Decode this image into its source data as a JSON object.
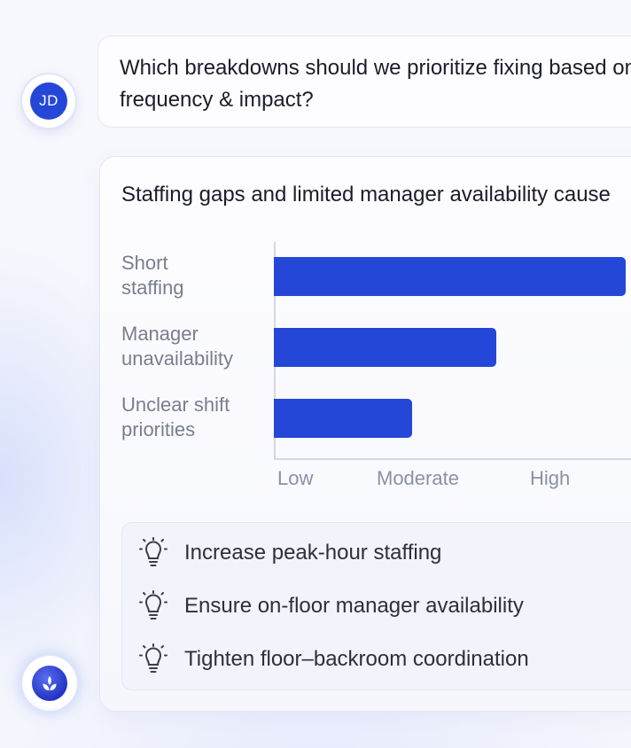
{
  "user": {
    "initials": "JD"
  },
  "question": {
    "line1": "Which breakdowns should we prioritize fixing based on",
    "line2": "frequency & impact?"
  },
  "answer": {
    "intro": "Staffing gaps and limited manager availability cause"
  },
  "chart_data": {
    "type": "bar",
    "orientation": "horizontal",
    "categories": [
      [
        "Short",
        "staffing"
      ],
      [
        "Manager",
        "unavailability"
      ],
      [
        "Unclear shift",
        "priorities"
      ]
    ],
    "values": [
      0.92,
      0.58,
      0.36
    ],
    "x_ticks": [
      "Low",
      "Moderate",
      "High"
    ],
    "color": "#2447d8",
    "grid": false
  },
  "recommendations": [
    {
      "icon": "lightbulb-icon",
      "text": "Increase peak-hour staffing"
    },
    {
      "icon": "lightbulb-icon",
      "text": "Ensure on-floor manager availability"
    },
    {
      "icon": "lightbulb-icon",
      "text": "Tighten floor–backroom coordination"
    }
  ],
  "assistant": {
    "icon": "leaf-icon"
  },
  "colors": {
    "accent": "#2447d8",
    "background": "#f7f8fd"
  }
}
